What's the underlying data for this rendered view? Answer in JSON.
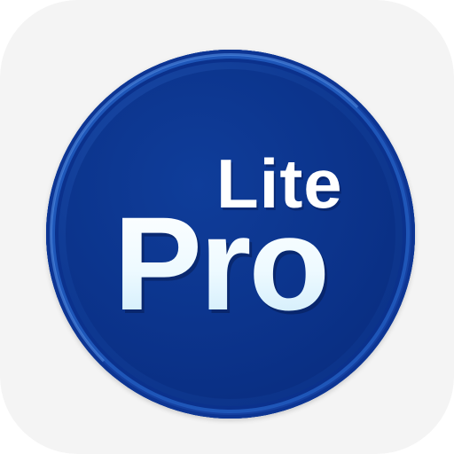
{
  "icon": {
    "lite_label": "Lite",
    "pro_label": "Pro"
  },
  "colors": {
    "tile_background": "#f4f4f4",
    "badge_blue": "#0f3a93",
    "badge_rim": "#1e56b8",
    "text_white": "#ffffff",
    "text_pale_blue": "#cdebfb"
  }
}
